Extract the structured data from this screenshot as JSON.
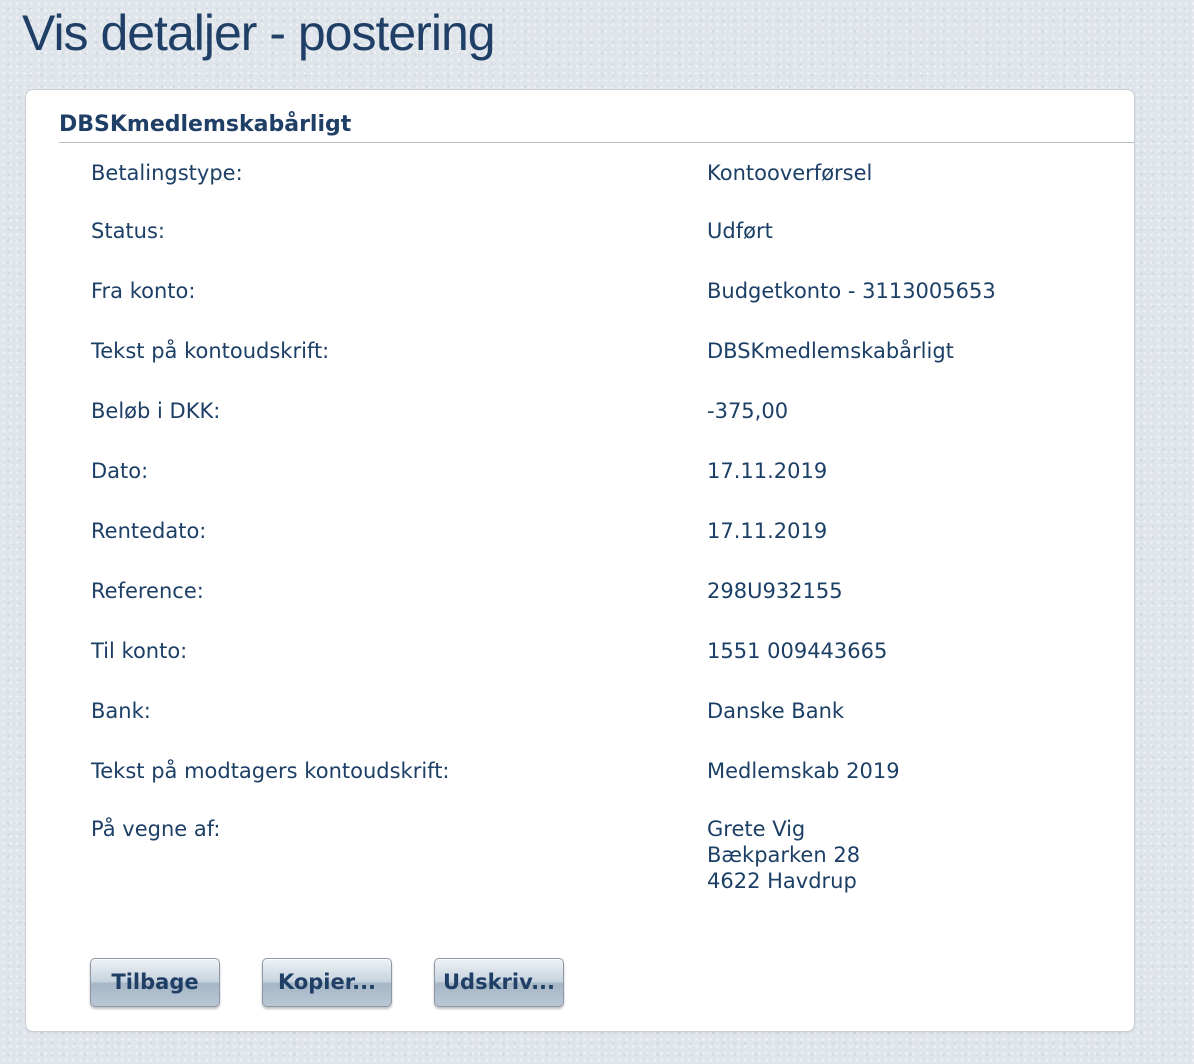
{
  "page": {
    "title": "Vis detaljer - postering"
  },
  "panel": {
    "title": "DBSKmedlemskabårligt"
  },
  "details": {
    "payment_type": {
      "label": "Betalingstype:",
      "value": "Kontooverførsel"
    },
    "status": {
      "label": "Status:",
      "value": "Udført"
    },
    "from_account": {
      "label": "Fra konto:",
      "value": "Budgetkonto - 3113005653"
    },
    "statement_text": {
      "label": "Tekst på kontoudskrift:",
      "value": "DBSKmedlemskabårligt"
    },
    "amount": {
      "label": "Beløb i DKK:",
      "value": "-375,00"
    },
    "date": {
      "label": "Dato:",
      "value": "17.11.2019"
    },
    "interest_date": {
      "label": "Rentedato:",
      "value": "17.11.2019"
    },
    "reference": {
      "label": "Reference:",
      "value": "298U932155"
    },
    "to_account": {
      "label": "Til konto:",
      "value": "1551 009443665"
    },
    "bank": {
      "label": "Bank:",
      "value": "Danske Bank"
    },
    "recipient_text": {
      "label": "Tekst på modtagers kontoudskrift:",
      "value": "Medlemskab 2019"
    },
    "on_behalf_of": {
      "label": "På vegne af:",
      "name": "Grete Vig",
      "street": "Bækparken 28",
      "city": "4622 Havdrup"
    }
  },
  "buttons": {
    "back": "Tilbage",
    "copy": "Kopier...",
    "print": "Udskriv..."
  }
}
